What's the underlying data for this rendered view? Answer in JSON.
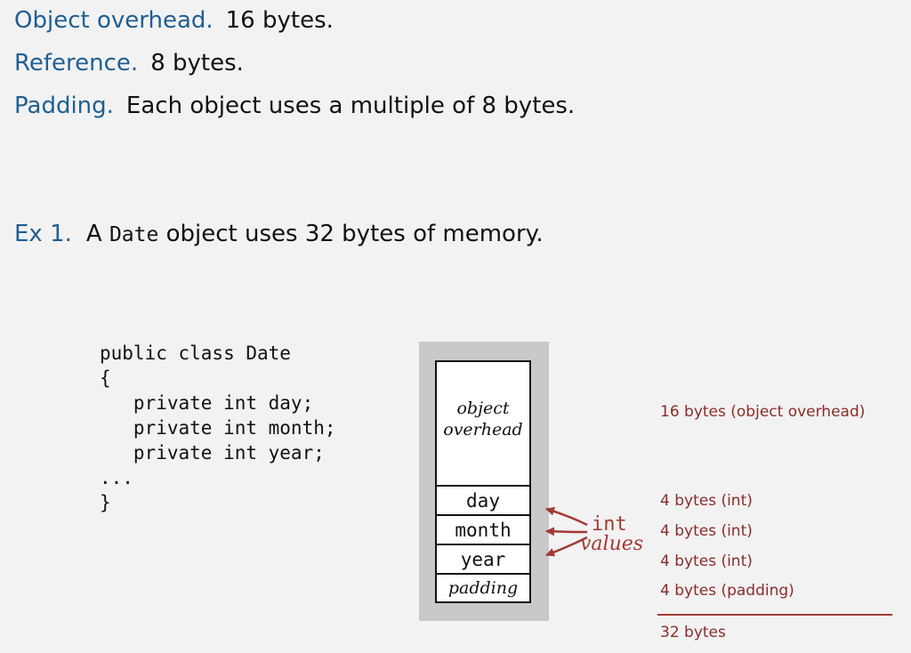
{
  "definitions": [
    {
      "term": "Object overhead.",
      "value": "16 bytes."
    },
    {
      "term": "Reference.",
      "value": "8 bytes."
    },
    {
      "term": "Padding.",
      "value": "Each object uses a multiple of 8 bytes."
    }
  ],
  "example": {
    "label": "Ex 1.",
    "text_before": "A",
    "class_name": "Date",
    "text_after": "object uses 32 bytes of memory."
  },
  "code_lines": [
    "public class Date",
    "{",
    "   private int day;",
    "   private int month;",
    "   private int year;",
    "...",
    "}"
  ],
  "memory_layout": {
    "overhead_line1": "object",
    "overhead_line2": "overhead",
    "fields": [
      "day",
      "month",
      "year"
    ],
    "padding": "padding",
    "annotation_mono": "int",
    "annotation_italic": "values",
    "annotation_color": "#a33a36"
  },
  "byte_sizes": {
    "overhead": "16 bytes (object overhead)",
    "day": "4 bytes (int)",
    "month": "4 bytes (int)",
    "year": "4 bytes (int)",
    "padding": "4 bytes (padding)",
    "total": "32 bytes"
  },
  "colors": {
    "term": "#1f5f93",
    "size_text": "#8b2c2a",
    "frame": "#c9c9c9",
    "background": "#f2f2f2"
  }
}
